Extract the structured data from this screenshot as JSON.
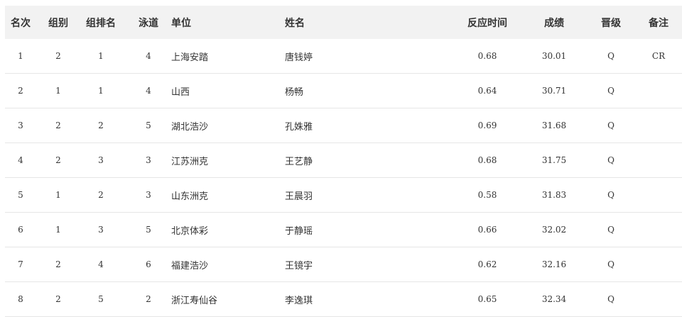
{
  "table": {
    "headers": {
      "rank": "名次",
      "group": "组别",
      "group_rank": "组排名",
      "lane": "泳道",
      "unit": "单位",
      "name": "姓名",
      "reaction_time": "反应时间",
      "result": "成绩",
      "qualify": "晋级",
      "note": "备注"
    },
    "rows": [
      {
        "rank": "1",
        "group": "2",
        "group_rank": "1",
        "lane": "4",
        "unit": "上海安踏",
        "name": "唐钱婷",
        "reaction_time": "0.68",
        "result": "30.01",
        "qualify": "Q",
        "note": "CR"
      },
      {
        "rank": "2",
        "group": "1",
        "group_rank": "1",
        "lane": "4",
        "unit": "山西",
        "name": "杨畅",
        "reaction_time": "0.64",
        "result": "30.71",
        "qualify": "Q",
        "note": ""
      },
      {
        "rank": "3",
        "group": "2",
        "group_rank": "2",
        "lane": "5",
        "unit": "湖北浩沙",
        "name": "孔姝雅",
        "reaction_time": "0.69",
        "result": "31.68",
        "qualify": "Q",
        "note": ""
      },
      {
        "rank": "4",
        "group": "2",
        "group_rank": "3",
        "lane": "3",
        "unit": "江苏洲克",
        "name": "王艺静",
        "reaction_time": "0.68",
        "result": "31.75",
        "qualify": "Q",
        "note": ""
      },
      {
        "rank": "5",
        "group": "1",
        "group_rank": "2",
        "lane": "3",
        "unit": "山东洲克",
        "name": "王晨羽",
        "reaction_time": "0.58",
        "result": "31.83",
        "qualify": "Q",
        "note": ""
      },
      {
        "rank": "6",
        "group": "1",
        "group_rank": "3",
        "lane": "5",
        "unit": "北京体彩",
        "name": "于静瑶",
        "reaction_time": "0.66",
        "result": "32.02",
        "qualify": "Q",
        "note": ""
      },
      {
        "rank": "7",
        "group": "2",
        "group_rank": "4",
        "lane": "6",
        "unit": "福建浩沙",
        "name": "王镜宇",
        "reaction_time": "0.62",
        "result": "32.16",
        "qualify": "Q",
        "note": ""
      },
      {
        "rank": "8",
        "group": "2",
        "group_rank": "5",
        "lane": "2",
        "unit": "浙江寿仙谷",
        "name": "李逸琪",
        "reaction_time": "0.65",
        "result": "32.34",
        "qualify": "Q",
        "note": ""
      }
    ]
  }
}
